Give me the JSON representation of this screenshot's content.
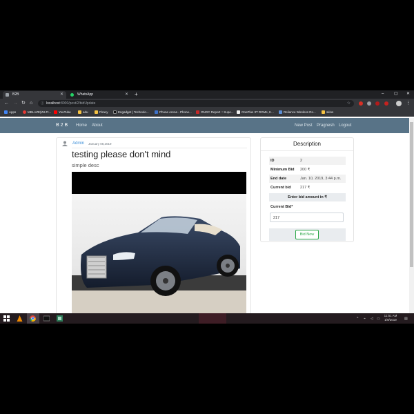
{
  "browser": {
    "tabs": [
      {
        "label": "B2B",
        "active": true
      },
      {
        "label": "WhatsApp",
        "active": false
      }
    ],
    "url_host": "localhost",
    "url_path": ":8000/post/2/bidUpdate",
    "bookmarks": [
      {
        "label": "Apps"
      },
      {
        "label": "MBLAZE(WI-FI..."
      },
      {
        "label": "YouTube"
      },
      {
        "label": "edu"
      },
      {
        "label": "Piracy"
      },
      {
        "label": "Engadget | Technolo..."
      },
      {
        "label": "Phone Arena - Phone..."
      },
      {
        "label": "ONGC Report :: Supe..."
      },
      {
        "label": "OnePlus 3T ROMs, K..."
      },
      {
        "label": "Reliance Wireless Ro..."
      },
      {
        "label": "skins"
      }
    ]
  },
  "site": {
    "brand": "B2B",
    "nav_left": [
      {
        "label": "Home"
      },
      {
        "label": "About"
      }
    ],
    "nav_right": [
      {
        "label": "New Post"
      },
      {
        "label": "Pragnesh"
      },
      {
        "label": "Logout"
      }
    ]
  },
  "post": {
    "author": "Admin",
    "date": "January 08,2019",
    "title": "testing please don't mind",
    "description": "simple desc"
  },
  "description_panel": {
    "heading": "Description",
    "rows": [
      {
        "label": "ID",
        "value": "2"
      },
      {
        "label": "Minimum Bid",
        "value": "200 ₹"
      },
      {
        "label": "End date",
        "value": "Jan. 10, 2019, 3:44 p.m."
      },
      {
        "label": "Current bid",
        "value": "217 ₹"
      }
    ],
    "bid_hint": "Enter bid amount in ₹",
    "bid_label": "Current Bid*",
    "bid_value": "217",
    "bid_button": "Bid Now"
  },
  "taskbar": {
    "time": "11:51 AM",
    "date": "1/9/2019"
  },
  "colors": {
    "navbar": "#587387",
    "link": "#3b8ed8",
    "success": "#28a745",
    "taskbar": "#241b1f"
  }
}
